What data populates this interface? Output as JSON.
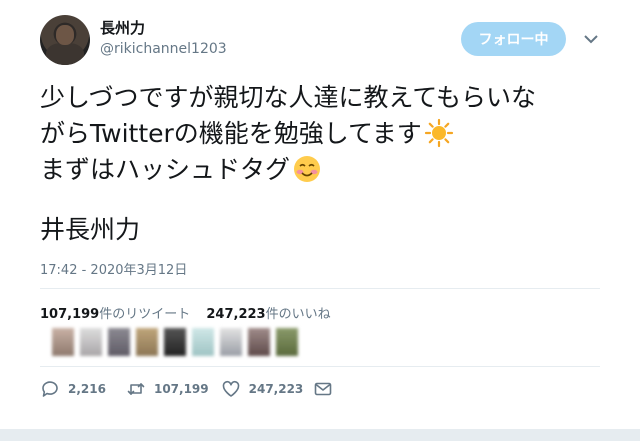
{
  "user": {
    "display_name": "長州力",
    "handle": "@rikichannel1203",
    "follow_button_label": "フォロー中"
  },
  "tweet": {
    "lines": [
      "少しづつですが親切な人達に教えてもらいな",
      "がらTwitterの機能を勉強してます",
      "まずはハッシュドタグ"
    ],
    "signature": "井長州力",
    "timestamp": "17:42 - 2020年3月12日"
  },
  "stats": {
    "retweet_count": "107,199",
    "retweet_suffix": "件のリツイート",
    "like_count": "247,223",
    "like_suffix": "件のいいね"
  },
  "actions": {
    "reply_count": "2,216",
    "retweet_count": "107,199",
    "like_count": "247,223"
  },
  "icons": [
    "chevron-down-icon",
    "sun-emoji-icon",
    "smiling-face-emoji-icon",
    "reply-icon",
    "retweet-icon",
    "heart-icon",
    "mail-icon"
  ],
  "colors": {
    "accent": "#1da1f2",
    "follow_button": "#a3d6f5",
    "muted_text": "#657786"
  }
}
